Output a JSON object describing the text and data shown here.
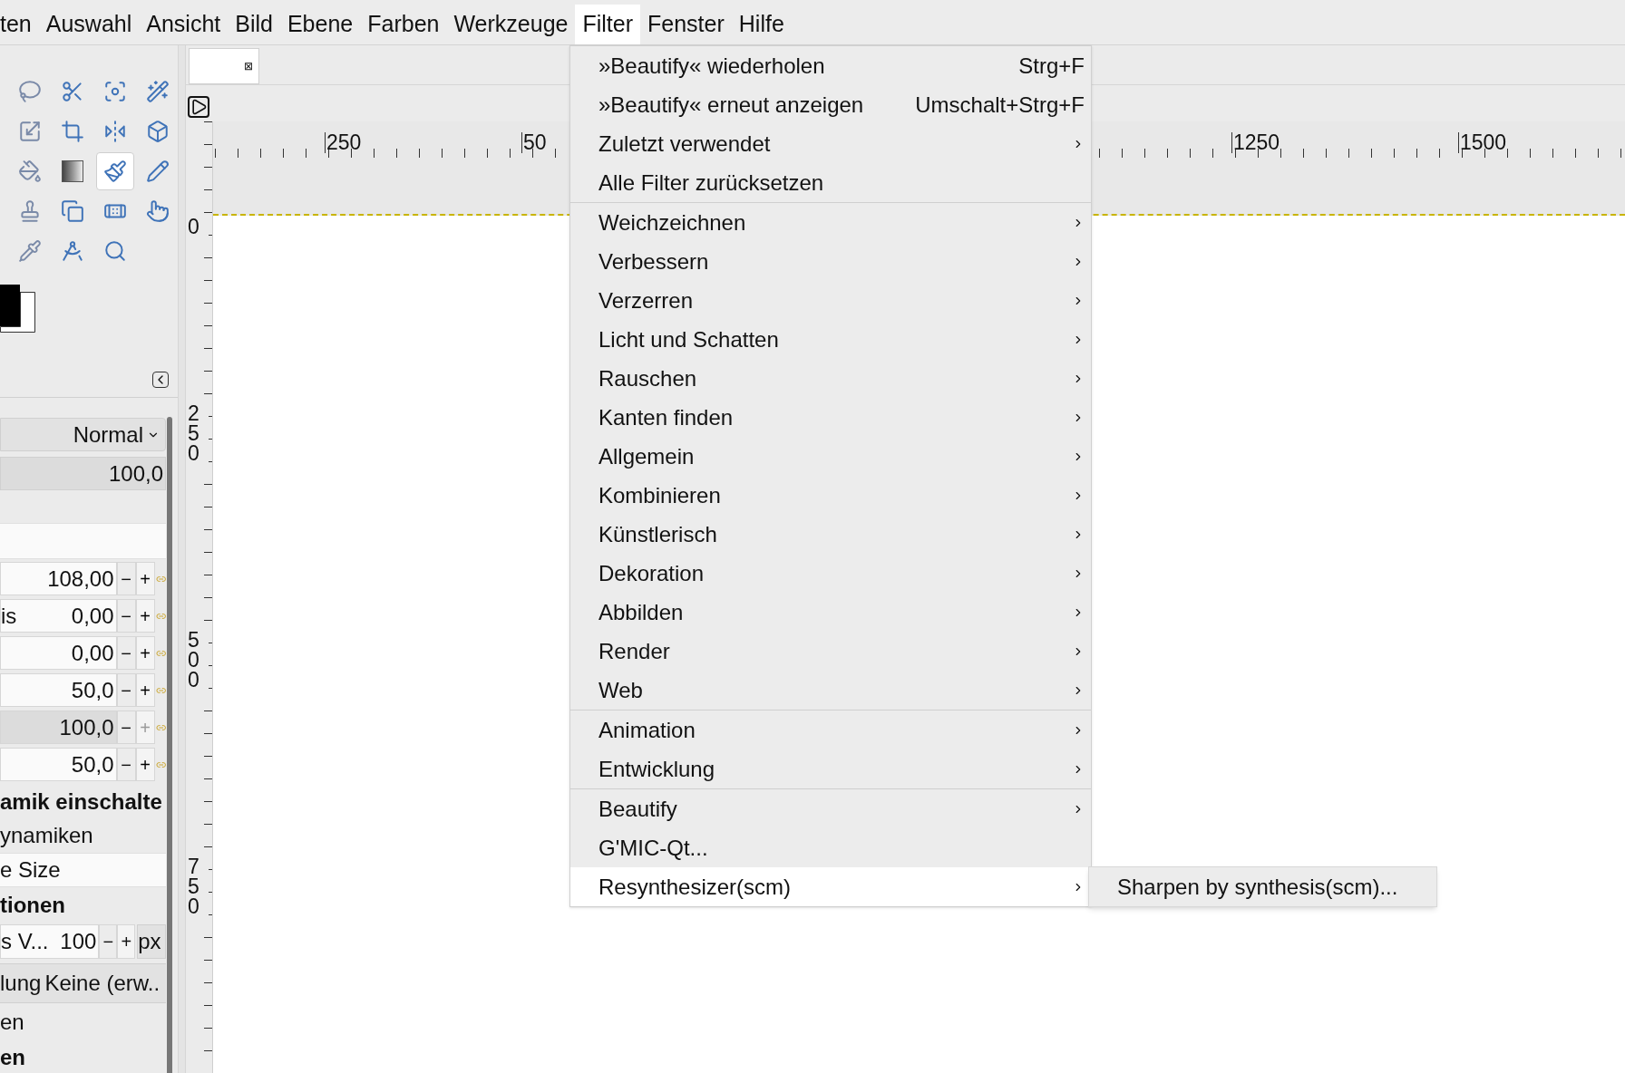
{
  "menubar": [
    {
      "label": "ten",
      "selected": false
    },
    {
      "label": "Auswahl",
      "selected": false
    },
    {
      "label": "Ansicht",
      "selected": false
    },
    {
      "label": "Bild",
      "selected": false
    },
    {
      "label": "Ebene",
      "selected": false
    },
    {
      "label": "Farben",
      "selected": false
    },
    {
      "label": "Werkzeuge",
      "selected": false
    },
    {
      "label": "Filter",
      "selected": true
    },
    {
      "label": "Fenster",
      "selected": false
    },
    {
      "label": "Hilfe",
      "selected": false
    }
  ],
  "toolbox": {
    "tools": [
      {
        "selected": false
      },
      {
        "selected": false
      },
      {
        "selected": false
      },
      {
        "selected": false
      },
      {
        "selected": false
      },
      {
        "selected": false
      },
      {
        "selected": false
      },
      {
        "selected": false
      },
      {
        "selected": false
      },
      {
        "selected": false
      },
      {
        "selected": true
      },
      {
        "selected": false
      },
      {
        "selected": false
      },
      {
        "selected": false
      },
      {
        "selected": false
      },
      {
        "selected": false
      },
      {
        "selected": false
      },
      {
        "selected": false
      },
      {
        "selected": false
      }
    ],
    "foreground": {
      "color": "#000000"
    },
    "background": {
      "color": "#ffffff"
    }
  },
  "tool_options": {
    "mode": "Normal",
    "opacity": {
      "value": "100,0",
      "level": 1
    },
    "spin_rows": [
      {
        "value": "108,00",
        "full": false,
        "minus": "−",
        "plus": "+",
        "plus_disabled": false
      },
      {
        "label": "is",
        "value": "0,00",
        "full": false,
        "minus": "−",
        "plus": "+",
        "plus_disabled": false
      },
      {
        "value": "0,00",
        "full": false,
        "minus": "−",
        "plus": "+",
        "plus_disabled": false
      },
      {
        "value": "50,0",
        "full": false,
        "minus": "−",
        "plus": "+",
        "plus_disabled": false
      },
      {
        "value": "100,0",
        "full": true,
        "minus": "−",
        "plus": "+",
        "plus_disabled": true
      },
      {
        "value": "50,0",
        "full": false,
        "minus": "−",
        "plus": "+",
        "plus_disabled": false
      }
    ],
    "dynamics_heading": "amik einschalte",
    "dynamics": "ynamiken",
    "dynamics_option": "e Size",
    "options_heading": "tionen",
    "size_row": {
      "label": "s V...",
      "value": "100",
      "minus": "−",
      "plus": "+",
      "unit": "px"
    },
    "smoothing": {
      "label": "lung",
      "value": "Keine (erw.."
    },
    "row_1": "en",
    "heading_2": "en"
  },
  "image_tab": {
    "close": "⊠"
  },
  "rulers": {
    "horizontal": [
      "250",
      "50",
      "1250",
      "1500"
    ],
    "vertical": [
      "0",
      "250",
      "500",
      "750"
    ]
  },
  "filter_menu": {
    "sections": [
      [
        {
          "label": "»Beautify« wiederholen",
          "shortcut": "Strg+F",
          "submenu": false,
          "selected": false
        },
        {
          "label": "»Beautify« erneut anzeigen",
          "shortcut": "Umschalt+Strg+F",
          "submenu": false,
          "selected": false
        },
        {
          "label": "Zuletzt verwendet",
          "submenu": true,
          "selected": false
        },
        {
          "label": "Alle Filter zurücksetzen",
          "submenu": false,
          "selected": false
        }
      ],
      [
        {
          "label": "Weichzeichnen",
          "submenu": true,
          "selected": false
        },
        {
          "label": "Verbessern",
          "submenu": true,
          "selected": false
        },
        {
          "label": "Verzerren",
          "submenu": true,
          "selected": false
        },
        {
          "label": "Licht und Schatten",
          "submenu": true,
          "selected": false
        },
        {
          "label": "Rauschen",
          "submenu": true,
          "selected": false
        },
        {
          "label": "Kanten finden",
          "submenu": true,
          "selected": false
        },
        {
          "label": "Allgemein",
          "submenu": true,
          "selected": false
        },
        {
          "label": "Kombinieren",
          "submenu": true,
          "selected": false
        },
        {
          "label": "Künstlerisch",
          "submenu": true,
          "selected": false
        },
        {
          "label": "Dekoration",
          "submenu": true,
          "selected": false
        },
        {
          "label": "Abbilden",
          "submenu": true,
          "selected": false
        },
        {
          "label": "Render",
          "submenu": true,
          "selected": false
        },
        {
          "label": "Web",
          "submenu": true,
          "selected": false
        }
      ],
      [
        {
          "label": "Animation",
          "submenu": true,
          "selected": false
        },
        {
          "label": "Entwicklung",
          "submenu": true,
          "selected": false
        }
      ],
      [
        {
          "label": "Beautify",
          "submenu": true,
          "selected": false
        },
        {
          "label": "G'MIC-Qt...",
          "submenu": false,
          "selected": false
        },
        {
          "label": "Resynthesizer(scm)",
          "submenu": true,
          "selected": true
        }
      ]
    ]
  },
  "submenu": {
    "items": [
      {
        "label": "Sharpen by synthesis(scm)..."
      }
    ]
  }
}
